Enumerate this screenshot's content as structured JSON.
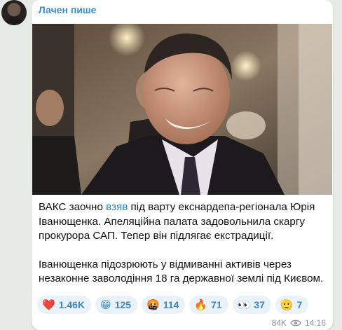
{
  "channel": {
    "name": "Лачен пише"
  },
  "post": {
    "paragraph1": {
      "before": "ВАКС заочно ",
      "link": "взяв",
      "after": " під варту екснардепа-регіонала Юрія Іванющенка. Апеляційна палата задовольнила скаргу прокурора САП. Тепер він підлягає екстрадиції."
    },
    "paragraph2": "Іванющенка підозрюють у відмиванні активів через незаконне заволодіння 18 га державної землі під Києвом.",
    "reactions": [
      {
        "emoji": "❤️",
        "count": "1.46K",
        "icon": "heart-icon"
      },
      {
        "emoji": "😁",
        "count": "125",
        "icon": "grin-icon"
      },
      {
        "emoji": "🤬",
        "count": "114",
        "icon": "cursing-face-icon"
      },
      {
        "emoji": "🔥",
        "count": "71",
        "icon": "fire-icon"
      },
      {
        "emoji": "👀",
        "count": "37",
        "icon": "eyes-icon"
      },
      {
        "emoji": "🫡",
        "count": "7",
        "icon": "salute-icon"
      }
    ],
    "views": "84K",
    "time": "14:16"
  }
}
